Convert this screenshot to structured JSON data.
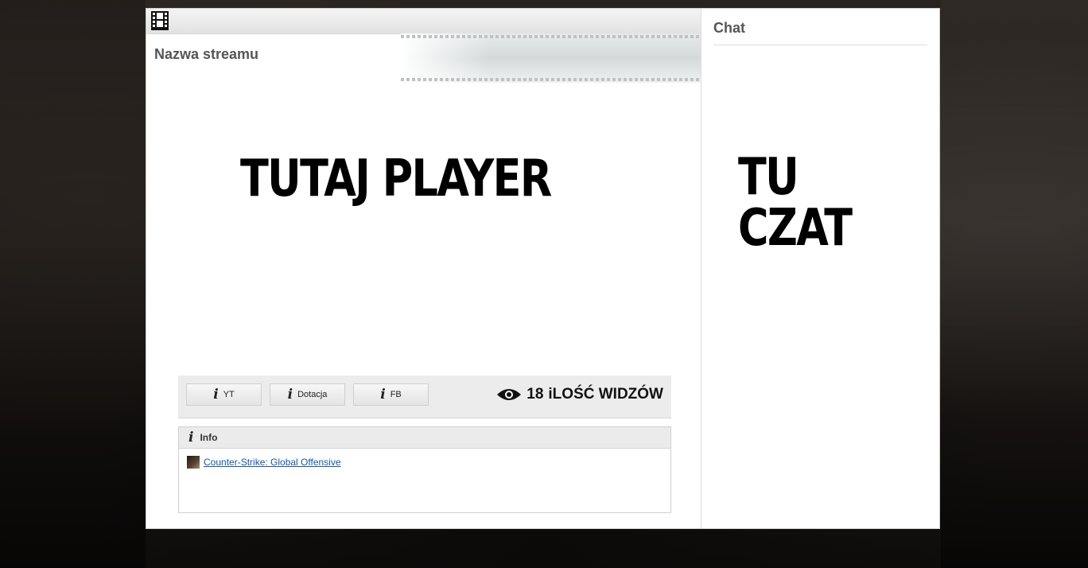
{
  "stream": {
    "title": "Nazwa streamu",
    "player_placeholder": "TUTAJ PLAYER"
  },
  "buttons": [
    {
      "label": "YT",
      "icon": "info-icon"
    },
    {
      "label": "Dotacja",
      "icon": "info-icon"
    },
    {
      "label": "FB",
      "icon": "info-icon"
    }
  ],
  "info_glyph": "i",
  "viewers": {
    "count": "18",
    "label": "iLOŚĆ WIDZÓW",
    "icon": "eye-icon"
  },
  "info": {
    "heading": "Info",
    "game_link": "Counter-Strike: Global Offensive"
  },
  "chat": {
    "title": "Chat",
    "placeholder": "TU CZAT"
  },
  "colors": {
    "link": "#1a56a6",
    "panel_bg": "#ffffff",
    "button_bar_bg": "#ececec"
  }
}
